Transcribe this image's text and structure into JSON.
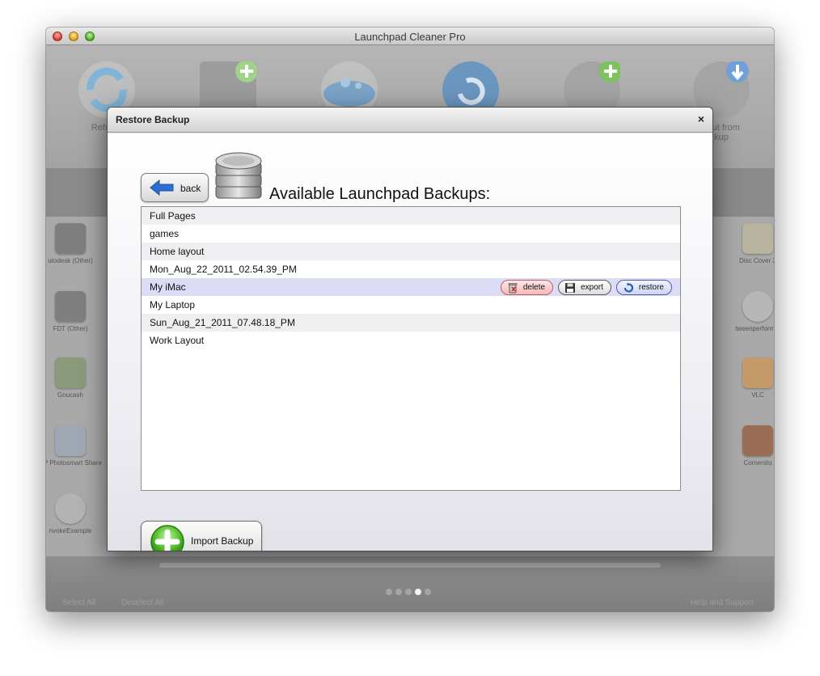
{
  "window": {
    "title": "Launchpad Cleaner Pro"
  },
  "toolbar": {
    "items": [
      {
        "label": "Refresh",
        "icon": "refresh-icon"
      },
      {
        "label": "",
        "icon": "add-page-icon"
      },
      {
        "label": "",
        "icon": "clean-icon"
      },
      {
        "label": "",
        "icon": "restore-icon"
      },
      {
        "label": "",
        "icon": "backup-add-icon"
      },
      {
        "label": "yout from\nkup",
        "icon": "backup-download-icon"
      }
    ]
  },
  "background_apps": {
    "left": [
      "utodesk (Other)",
      "FDT (Other)",
      "Gnucash",
      "HP Photosmart Share",
      "nvokeExample"
    ],
    "right": [
      "Disc Cover 2",
      "tweenperform e",
      "VLC",
      "Cornersto"
    ]
  },
  "bottom_bar": {
    "select_all": "Select All",
    "deselect_all": "Deselect All",
    "help": "Help and Support",
    "page_count": 5,
    "active_page": 4
  },
  "dialog": {
    "title": "Restore Backup",
    "close_glyph": "×",
    "back_label": "back",
    "heading": "Available Launchpad Backups:",
    "import_label": "Import Backup",
    "backups": [
      {
        "name": "Full Pages"
      },
      {
        "name": "games"
      },
      {
        "name": "Home layout"
      },
      {
        "name": "Mon_Aug_22_2011_02.54.39_PM"
      },
      {
        "name": "My iMac"
      },
      {
        "name": "My Laptop"
      },
      {
        "name": "Sun_Aug_21_2011_07.48.18_PM"
      },
      {
        "name": "Work Layout"
      }
    ],
    "selected_backup": "My iMac",
    "row_actions": {
      "delete": "delete",
      "export": "export",
      "restore": "restore"
    }
  },
  "colors": {
    "selected_row": "#dcdcf7",
    "alt_row": "#efeff1",
    "accent_blue": "#2c6fd0",
    "import_green": "#57c22e"
  }
}
